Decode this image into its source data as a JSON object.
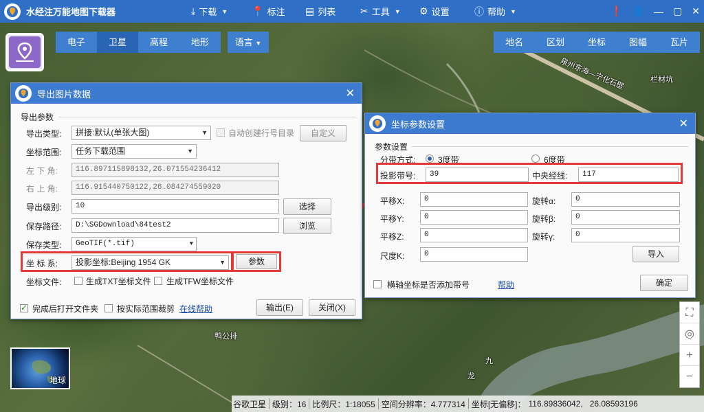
{
  "app": {
    "title": "水经注万能地图下载器"
  },
  "menu": [
    {
      "icon": "download-icon",
      "glyph": "⤓",
      "label": "下载",
      "caret": true
    },
    {
      "icon": "location-pin-icon",
      "glyph": "⬤",
      "label": "标注",
      "caret": false
    },
    {
      "icon": "list-icon",
      "glyph": "▤",
      "label": "列表",
      "caret": false
    },
    {
      "icon": "tools-icon",
      "glyph": "✕",
      "label": "工具",
      "caret": true
    },
    {
      "icon": "gear-icon",
      "glyph": "⚙",
      "label": "设置",
      "caret": false
    },
    {
      "icon": "help-icon",
      "glyph": "?",
      "label": "帮助",
      "caret": true
    }
  ],
  "map_tabs": [
    "电子",
    "卫星",
    "高程",
    "地形"
  ],
  "map_tab_active": "卫星",
  "language_label": "语言",
  "right_tabs": [
    "地名",
    "区划",
    "坐标",
    "图幅",
    "瓦片"
  ],
  "map_labels": {
    "road": "泉州东海—宁化石壁",
    "village1": "栏材坑",
    "village2": "鸭公排",
    "river1": "九",
    "river2": "龙"
  },
  "export_dialog": {
    "title": "导出图片数据",
    "group": "导出参数",
    "type_label": "导出类型:",
    "type_value": "拼接:默认(单张大图)",
    "auto_create_label": "自动创建行号目录",
    "custom_button": "自定义",
    "range_label": "坐标范围:",
    "range_value": "任务下载范围",
    "bottom_left_label": "左 下 角:",
    "bottom_left_value": "116.897115898132,26.071554236412",
    "top_right_label": "右 上 角:",
    "top_right_value": "116.915440750122,26.084274559020",
    "level_label": "导出级别:",
    "level_value": "10",
    "select_button": "选择",
    "path_label": "保存路径:",
    "path_value": "D:\\SGDownload\\84test2",
    "browse_button": "浏览",
    "save_type_label": "保存类型:",
    "save_type_value": "GeoTIF(*.tif)",
    "crs_label": "坐 标 系:",
    "crs_value": "投影坐标:Beijing 1954 GK",
    "params_button": "参数",
    "coord_file_label": "坐标文件:",
    "gen_txt_label": "生成TXT坐标文件",
    "gen_tfw_label": "生成TFW坐标文件",
    "open_folder_label": "完成后打开文件夹",
    "crop_label": "按实际范围裁剪",
    "online_help": "在线帮助",
    "export_button": "输出(E)",
    "close_button": "关闭(X)"
  },
  "crs_dialog": {
    "title": "坐标参数设置",
    "group": "参数设置",
    "zone_method_label": "分带方式:",
    "zone_3": "3度带",
    "zone_6": "6度带",
    "zone_no_label": "投影带号:",
    "zone_no_value": "39",
    "central_meridian_label": "中央经线:",
    "central_meridian_value": "117",
    "shift_x_label": "平移X:",
    "shift_x_value": "0",
    "rot_a_label": "旋转α:",
    "rot_a_value": "0",
    "shift_y_label": "平移Y:",
    "shift_y_value": "0",
    "rot_b_label": "旋转β:",
    "rot_b_value": "0",
    "shift_z_label": "平移Z:",
    "shift_z_value": "0",
    "rot_g_label": "旋转γ:",
    "rot_g_value": "0",
    "scale_label": "尺度K:",
    "scale_value": "0",
    "import_button": "导入",
    "add_zone_label": "横轴坐标是否添加带号",
    "help_link": "帮助",
    "ok_button": "确定"
  },
  "globe_label": "地球",
  "status": {
    "source": "谷歌卫星",
    "level": "级别：16",
    "scale": "比例尺：1:18055",
    "resolution": "空间分辨率：4.777314",
    "coord_label": "坐标[无偏移]：",
    "lon": "116.89836042,",
    "lat": "26.08593196"
  },
  "colors": {
    "titlebar": "#2f6fc5",
    "accent_red": "#e23a3a",
    "tab": "#3f7fd0"
  }
}
